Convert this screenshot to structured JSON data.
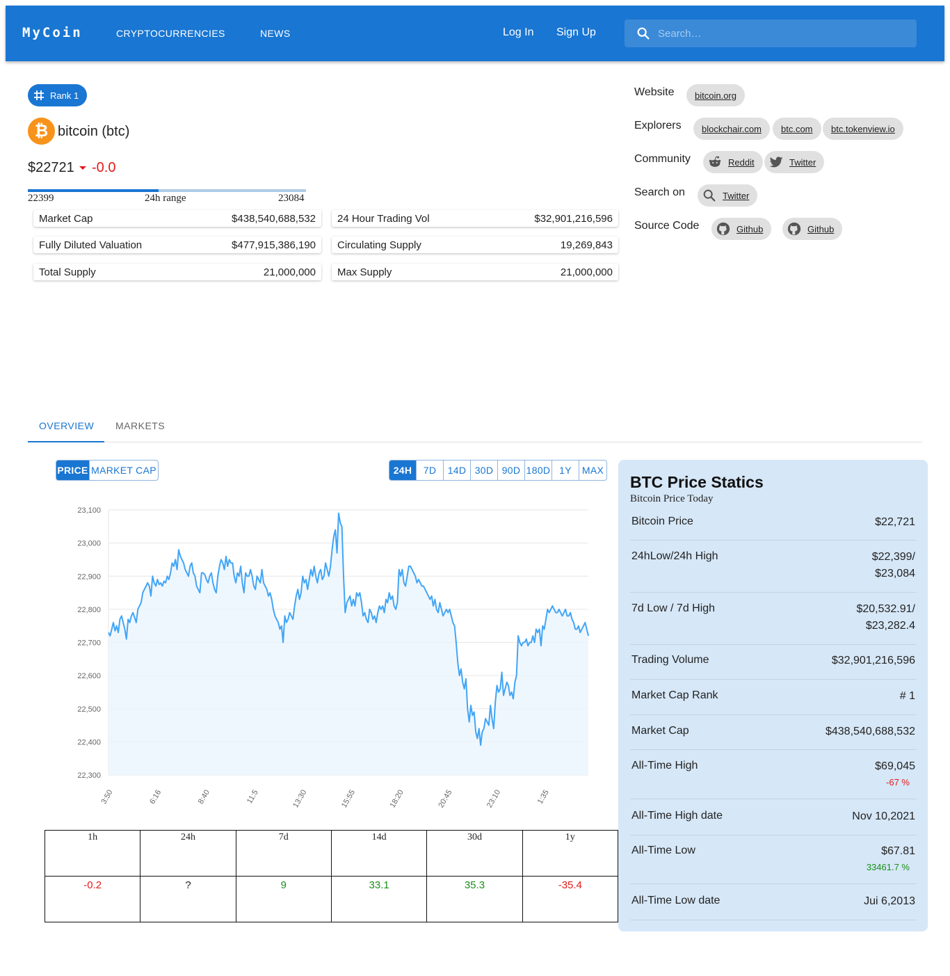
{
  "appbar": {
    "logo": "MyCoin",
    "nav": [
      "CRYPTOCURRENCIES",
      "NEWS"
    ],
    "login": "Log In",
    "signup": "Sign Up",
    "search_placeholder": "Search…"
  },
  "coin": {
    "rank_label": "Rank 1",
    "name": "bitcoin (btc)",
    "logo_glyph": "₿",
    "price": "$22721",
    "change": "-0.0",
    "range_low": "22399",
    "range_label": "24h range",
    "range_high": "23084",
    "range_position": 0.47
  },
  "stats": [
    {
      "label": "Market Cap",
      "value": "$438,540,688,532"
    },
    {
      "label": "24 Hour Trading Vol",
      "value": "$32,901,216,596"
    },
    {
      "label": "Fully Diluted Valuation",
      "value": "$477,915,386,190"
    },
    {
      "label": "Circulating Supply",
      "value": "19,269,843"
    },
    {
      "label": "Total Supply",
      "value": "21,000,000"
    },
    {
      "label": "Max Supply",
      "value": "21,000,000"
    }
  ],
  "links": {
    "website_label": "Website",
    "website": [
      "bitcoin.org"
    ],
    "explorers_label": "Explorers",
    "explorers": [
      "blockchair.com",
      "btc.com",
      "btc.tokenview.io"
    ],
    "community_label": "Community",
    "community": [
      "Reddit",
      "Twitter"
    ],
    "search_label": "Search on",
    "search": [
      "Twitter"
    ],
    "source_label": "Source Code",
    "source": [
      "Github",
      "Github"
    ]
  },
  "tabs": [
    "OVERVIEW",
    "MARKETS"
  ],
  "chart_controls": {
    "metric": [
      "PRICE",
      "MARKET CAP"
    ],
    "ranges": [
      "24H",
      "7D",
      "14D",
      "30D",
      "90D",
      "180D",
      "1Y",
      "MAX"
    ]
  },
  "colors": {
    "primary": "#1976d2",
    "negative": "#e31b1b",
    "positive": "#1a8f1a",
    "line": "#42a5f5",
    "panel": "#d6e7f7"
  },
  "chart_data": {
    "type": "area",
    "ylim": [
      22300,
      23100
    ],
    "yticks": [
      "22,300",
      "22,400",
      "22,500",
      "22,600",
      "22,700",
      "22,800",
      "22,900",
      "23,000",
      "23,100"
    ],
    "xticks": [
      "3:50",
      "6:16",
      "8:40",
      "11:5",
      "13:30",
      "15:55",
      "18:20",
      "20:45",
      "23:10",
      "1:35"
    ],
    "values": [
      22730,
      22720,
      22740,
      22760,
      22735,
      22750,
      22730,
      22770,
      22780,
      22760,
      22740,
      22710,
      22770,
      22760,
      22780,
      22790,
      22775,
      22760,
      22800,
      22810,
      22820,
      22850,
      22860,
      22870,
      22880,
      22870,
      22840,
      22900,
      22880,
      22870,
      22890,
      22875,
      22880,
      22870,
      22885,
      22880,
      22900,
      22890,
      22910,
      22940,
      22930,
      22950,
      22920,
      22980,
      22960,
      22950,
      22940,
      22920,
      22910,
      22900,
      22930,
      22940,
      22910,
      22900,
      22870,
      22860,
      22850,
      22910,
      22910,
      22905,
      22890,
      22880,
      22900,
      22910,
      22880,
      22860,
      22850,
      22900,
      22930,
      22950,
      22940,
      22920,
      22960,
      22930,
      22950,
      22940,
      22940,
      22900,
      22880,
      22910,
      22900,
      22930,
      22880,
      22850,
      22910,
      22900,
      22900,
      22920,
      22900,
      22870,
      22860,
      22900,
      22890,
      22880,
      22920,
      22880,
      22870,
      22860,
      22840,
      22850,
      22830,
      22800,
      22780,
      22770,
      22760,
      22740,
      22750,
      22700,
      22780,
      22760,
      22770,
      22790,
      22780,
      22770,
      22810,
      22840,
      22860,
      22830,
      22850,
      22900,
      22880,
      22890,
      22860,
      22890,
      22920,
      22900,
      22930,
      22900,
      22880,
      22910,
      22920,
      22890,
      22900,
      22940,
      22920,
      22900,
      22930,
      22980,
      23020,
      23040,
      22970,
      23090,
      23060,
      23050,
      22900,
      22790,
      22820,
      22830,
      22840,
      22810,
      22830,
      22810,
      22850,
      22840,
      22850,
      22820,
      22780,
      22790,
      22770,
      22760,
      22800,
      22790,
      22770,
      22780,
      22760,
      22790,
      22810,
      22800,
      22810,
      22790,
      22830,
      22820,
      22850,
      22830,
      22840,
      22810,
      22800,
      22820,
      22920,
      22900,
      22920,
      22880,
      22870,
      22900,
      22930,
      22930,
      22920,
      22910,
      22900,
      22880,
      22890,
      22880,
      22870,
      22870,
      22860,
      22850,
      22840,
      22830,
      22840,
      22810,
      22830,
      22800,
      22790,
      22820,
      22800,
      22780,
      22790,
      22800,
      22790,
      22800,
      22780,
      22760,
      22750,
      22700,
      22640,
      22600,
      22620,
      22580,
      22560,
      22590,
      22500,
      22460,
      22510,
      22480,
      22490,
      22430,
      22410,
      22440,
      22390,
      22430,
      22440,
      22470,
      22460,
      22450,
      22510,
      22470,
      22440,
      22520,
      22570,
      22550,
      22560,
      22610,
      22540,
      22560,
      22580,
      22570,
      22540,
      22550,
      22530,
      22580,
      22600,
      22720,
      22700,
      22690,
      22700,
      22700,
      22710,
      22690,
      22700,
      22700,
      22720,
      22700,
      22740,
      22730,
      22740,
      22690,
      22750,
      22740,
      22770,
      22800,
      22790,
      22800,
      22810,
      22800,
      22790,
      22790,
      22800,
      22790,
      22780,
      22790,
      22800,
      22780,
      22780,
      22790,
      22770,
      22760,
      22740,
      22740,
      22750,
      22730,
      22740,
      22750,
      22760,
      22740,
      22720
    ]
  },
  "performance": {
    "headers": [
      "1h",
      "24h",
      "7d",
      "14d",
      "30d",
      "1y"
    ],
    "values": [
      {
        "v": "-0.2",
        "sign": "neg"
      },
      {
        "v": "?",
        "sign": "neu"
      },
      {
        "v": "9",
        "sign": "pos"
      },
      {
        "v": "33.1",
        "sign": "pos"
      },
      {
        "v": "35.3",
        "sign": "pos"
      },
      {
        "v": "-35.4",
        "sign": "neg"
      }
    ]
  },
  "panel": {
    "title": "BTC Price Statics",
    "subtitle": "Bitcoin Price Today",
    "rows": [
      {
        "k": "Bitcoin Price",
        "v": "$22,721"
      },
      {
        "k": "24hLow/24h High",
        "v": "$22,399/",
        "v2": "$23,084"
      },
      {
        "k": "7d Low / 7d High",
        "v": "$20,532.91/",
        "v2": "$23,282.4"
      },
      {
        "k": "Trading Volume",
        "v": "$32,901,216,596"
      },
      {
        "k": "Market Cap Rank",
        "v": "# 1"
      },
      {
        "k": "Market Cap",
        "v": "$438,540,688,532"
      },
      {
        "k": "All-Time High",
        "v": "$69,045",
        "pct": "-67 %",
        "pct_sign": "neg"
      },
      {
        "k": "All-Time High date",
        "v": "Nov 10,2021"
      },
      {
        "k": "All-Time Low",
        "v": "$67.81",
        "pct": "33461.7 %",
        "pct_sign": "pos"
      },
      {
        "k": "All-Time Low date",
        "v": "Jui 6,2013"
      }
    ]
  }
}
